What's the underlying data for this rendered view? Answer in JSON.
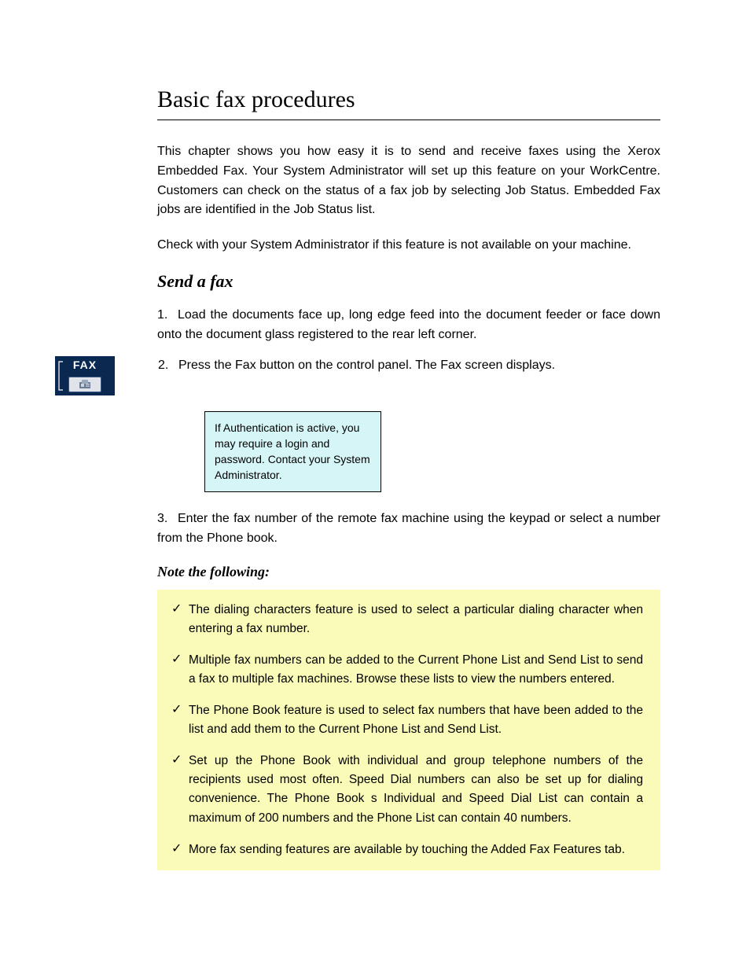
{
  "page": {
    "title": "Basic fax procedures",
    "intro1": "This chapter shows you how easy it is to send and receive faxes using the Xerox Embedded Fax. Your System Administrator will set up this feature on your WorkCentre. Customers can check on the status of a fax job by selecting Job Status. Embedded Fax jobs are identified in the Job Status list.",
    "intro2": "Check with your System Administrator if this feature is not available on your machine.",
    "section_heading": "Send a fax",
    "step1_lead": "1.",
    "step1_text": "Load the documents face up, long edge feed into the document feeder or face down onto the document glass registered to the rear left corner.",
    "step2_lead": "2.",
    "step2_text": "Press the Fax button on the control panel. The Fax screen displays.",
    "info_box": "If Authentication is active, you may require a login and password. Contact your System Administrator.",
    "step3_lead": "3.",
    "step3_text": "Enter the fax number of the remote fax machine using the keypad or select a number from the Phone book.",
    "notes_lead": "Note the following:",
    "notes": [
      "The dialing characters feature is used to select a particular dialing character when entering a fax number.",
      "Multiple fax numbers can be added to the Current Phone List and Send List to send a fax to multiple fax machines. Browse these lists to view the numbers entered.",
      "The Phone Book feature is used to select fax numbers that have been added to the list and add them to the Current Phone List and Send List.",
      "Set up the Phone Book with individual and group telephone numbers of the recipients used most often. Speed Dial numbers can also be set up for dialing convenience. The Phone Book s Individual and Speed Dial List can contain a maximum of 200 numbers and the Phone List can contain 40 numbers.",
      "More fax sending features are available by touching the Added Fax Features tab."
    ],
    "fax_label": "FAX"
  }
}
